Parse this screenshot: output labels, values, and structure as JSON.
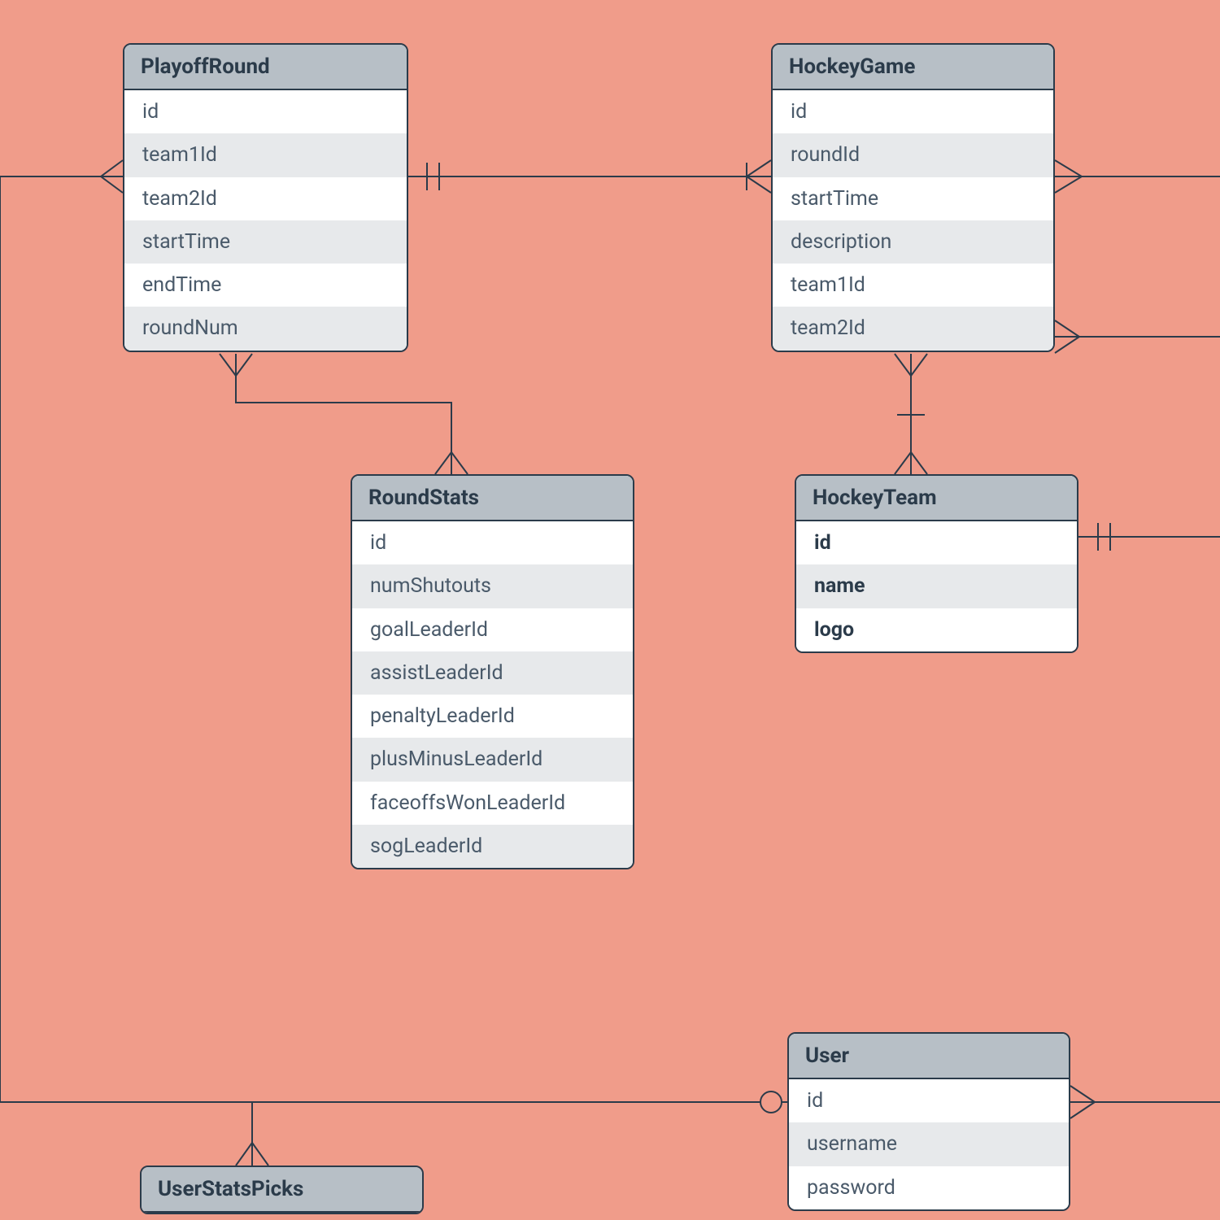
{
  "entities": {
    "playoffRound": {
      "title": "PlayoffRound",
      "fields": [
        "id",
        "team1Id",
        "team2Id",
        "startTime",
        "endTime",
        "roundNum"
      ]
    },
    "hockeyGame": {
      "title": "HockeyGame",
      "fields": [
        "id",
        "roundId",
        "startTime",
        "description",
        "team1Id",
        "team2Id"
      ]
    },
    "roundStats": {
      "title": "RoundStats",
      "fields": [
        "id",
        "numShutouts",
        "goalLeaderId",
        "assistLeaderId",
        "penaltyLeaderId",
        "plusMinusLeaderId",
        "faceoffsWonLeaderId",
        "sogLeaderId"
      ]
    },
    "hockeyTeam": {
      "title": "HockeyTeam",
      "fields": [
        "id",
        "name",
        "logo"
      ],
      "bold": true
    },
    "user": {
      "title": "User",
      "fields": [
        "id",
        "username",
        "password"
      ]
    },
    "userStatsPicks": {
      "title": "UserStatsPicks",
      "fields": []
    }
  }
}
